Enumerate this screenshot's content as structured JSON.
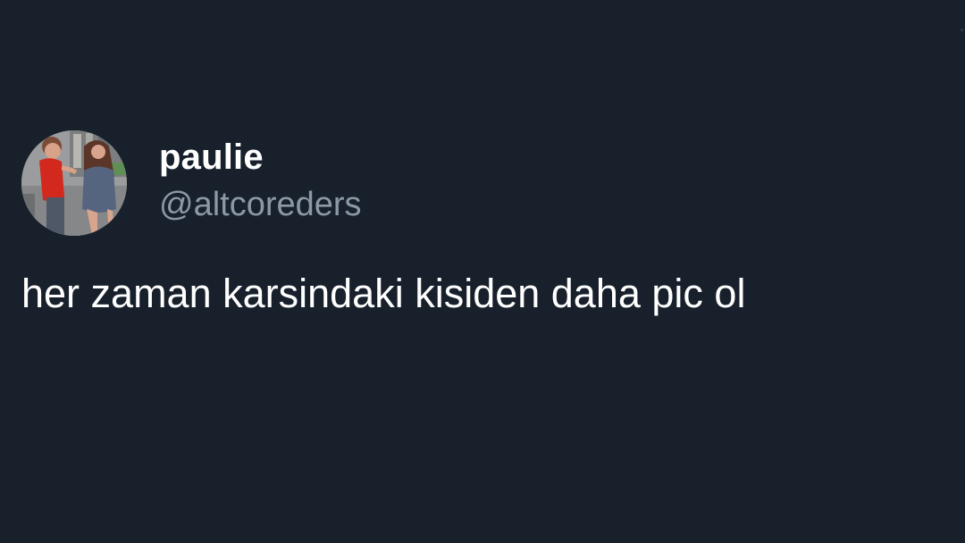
{
  "tweet": {
    "author": {
      "display_name": "paulie",
      "handle": "@altcoreders",
      "avatar_icon": "profile-photo-icon"
    },
    "text": "her zaman karsindaki kisiden daha pic ol"
  },
  "colors": {
    "background": "#17202b",
    "primary_text": "#ffffff",
    "secondary_text": "#8b98a5"
  }
}
